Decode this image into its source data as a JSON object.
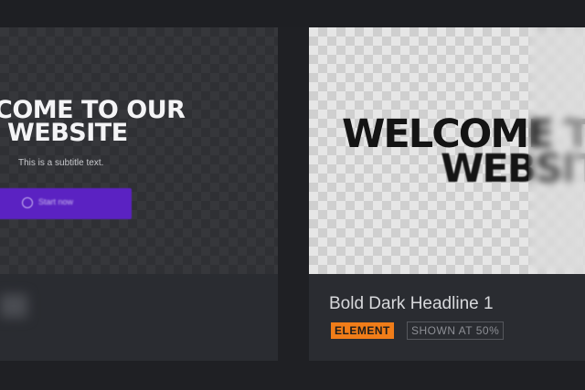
{
  "left_card": {
    "heading_line1": "COME TO OUR",
    "heading_line2": "WEBSITE",
    "subtitle": "This is a subtitle text.",
    "cta_label": "Start now",
    "colors": {
      "cta_background": "#5b22c2",
      "preview_background": "#2f3034"
    }
  },
  "right_card": {
    "preview_line1": "WELCOME T",
    "preview_line2": "WEBSITE",
    "name": "Bold Dark Headline 1",
    "type_badge": "ELEMENT",
    "scale_badge": "SHOWN AT 50%",
    "colors": {
      "type_badge": "#f07d19",
      "card_background": "#2a2c31"
    }
  }
}
